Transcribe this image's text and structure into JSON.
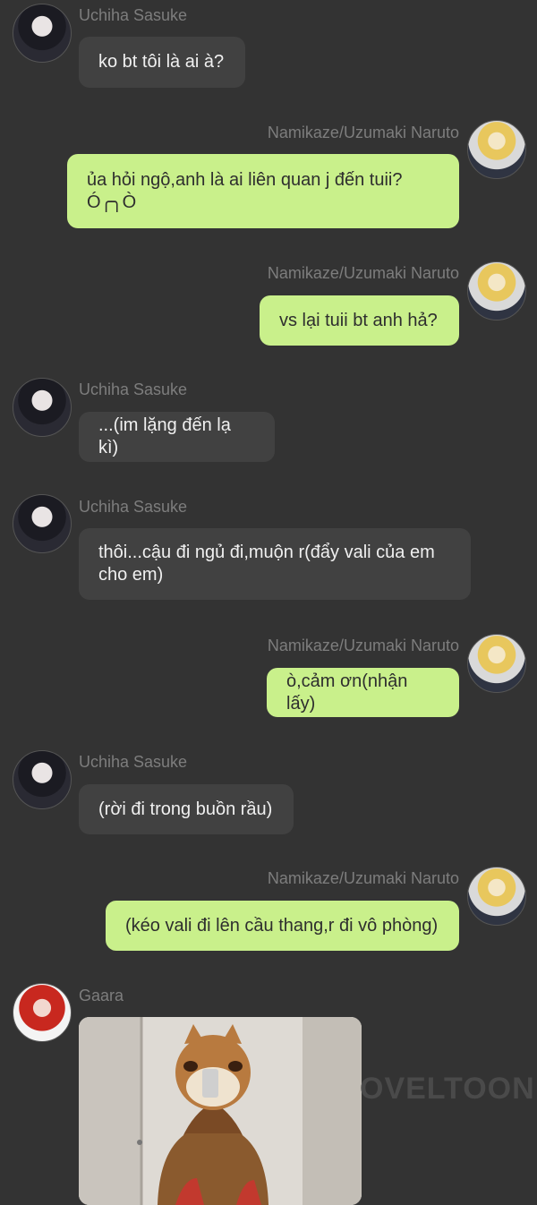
{
  "messages": [
    {
      "sender": "Uchiha Sasuke",
      "text": "ko bt tôi là ai à?"
    },
    {
      "sender": "Namikaze/Uzumaki Naruto",
      "text": "ủa hỏi ngộ,anh là ai liên quan j đến tuii?\nÓ╭╮Ò"
    },
    {
      "sender": "Namikaze/Uzumaki Naruto",
      "text": "vs lại tuii bt anh hả?"
    },
    {
      "sender": "Uchiha Sasuke",
      "text": "...(im lặng đến lạ kì)"
    },
    {
      "sender": "Uchiha Sasuke",
      "text": "thôi...cậu đi ngủ đi,muộn r(đẩy vali của em\ncho em)"
    },
    {
      "sender": "Namikaze/Uzumaki Naruto",
      "text": "ò,cảm ơn(nhận lấy)"
    },
    {
      "sender": "Uchiha Sasuke",
      "text": "(rời đi trong buồn rầu)"
    },
    {
      "sender": "Namikaze/Uzumaki Naruto",
      "text": "(kéo vali đi lên cầu thang,r đi vô phòng)"
    },
    {
      "sender": "Gaara",
      "text": ""
    }
  ],
  "watermark": "OVELTOON"
}
